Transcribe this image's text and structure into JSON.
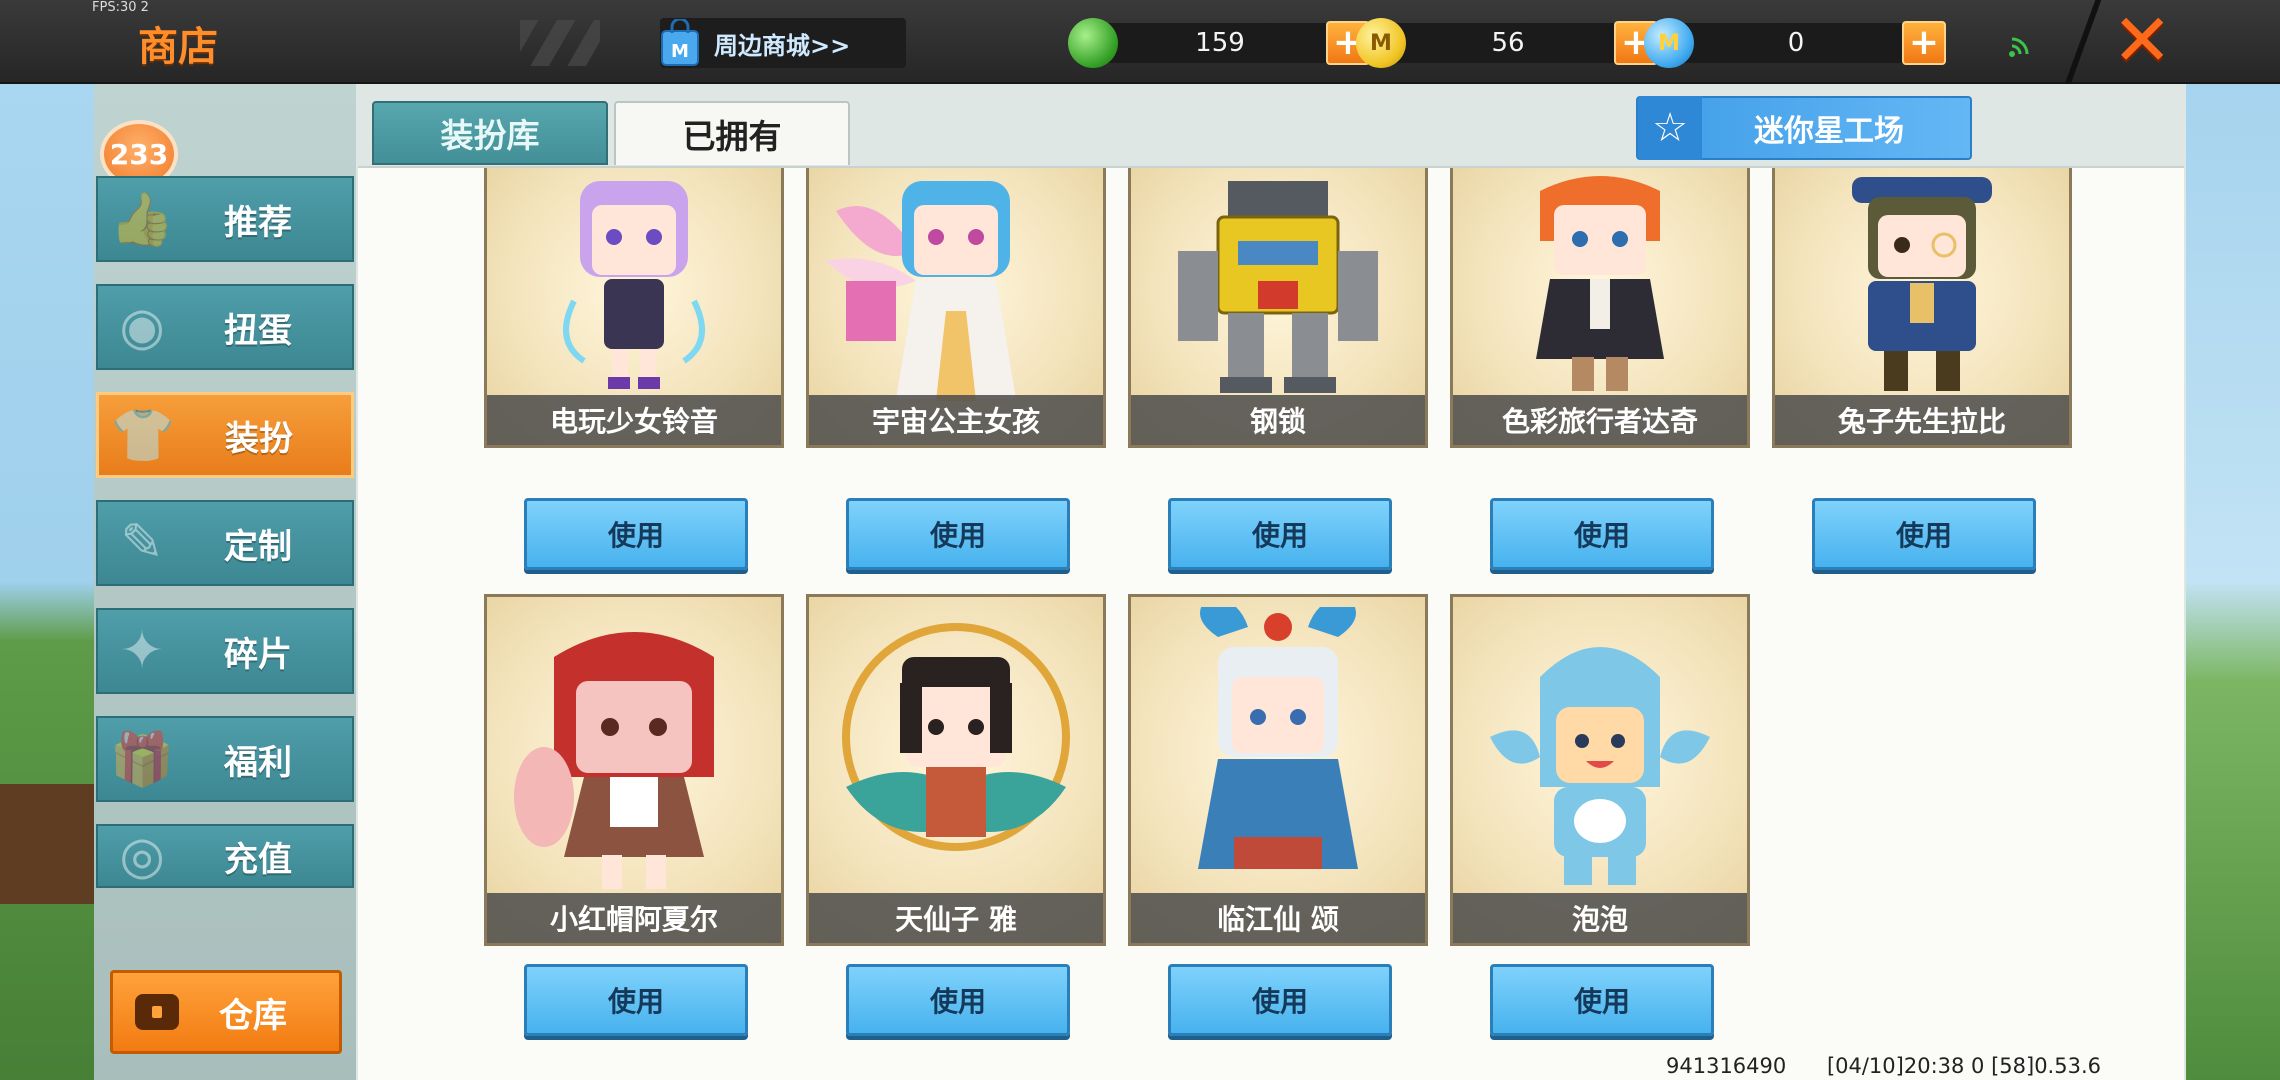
{
  "fps_text": "FPS:30 2",
  "header": {
    "title": "商店",
    "mall_link": "周边商城>>",
    "currencies": [
      {
        "name": "mini-bean",
        "value": "159",
        "icon": "green-gem-icon",
        "color": "#2f9c22"
      },
      {
        "name": "mini-coin",
        "value": "56",
        "icon": "gold-coin-icon",
        "color": "#f0c423"
      },
      {
        "name": "star-coin",
        "value": "0",
        "icon": "blue-coin-icon",
        "color": "#3ea9ef"
      }
    ],
    "plus_label": "+",
    "close_label": "✕",
    "coin_letter": "M"
  },
  "sidebar": {
    "badge_count": "233",
    "items": [
      {
        "label": "推荐",
        "icon": "thumbs-up-icon",
        "glyph": "👍",
        "active": false
      },
      {
        "label": "扭蛋",
        "icon": "capsule-icon",
        "glyph": "◉",
        "active": false
      },
      {
        "label": "装扮",
        "icon": "shirt-icon",
        "glyph": "👕",
        "active": true
      },
      {
        "label": "定制",
        "icon": "pencil-icon",
        "glyph": "✎",
        "active": false
      },
      {
        "label": "碎片",
        "icon": "puzzle-icon",
        "glyph": "✦",
        "active": false
      },
      {
        "label": "福利",
        "icon": "gift-icon",
        "glyph": "🎁",
        "active": false
      },
      {
        "label": "充值",
        "icon": "coin-stack-icon",
        "glyph": "◎",
        "active": false
      }
    ],
    "storage_label": "仓库"
  },
  "tabs": [
    {
      "label": "装扮库",
      "active": false
    },
    {
      "label": "已拥有",
      "active": true
    }
  ],
  "workshop_label": "迷你星工场",
  "use_label": "使用",
  "skins": [
    {
      "name": "电玩少女铃音",
      "hair": "#c9a4ec",
      "outfit": "#3b3554",
      "accent": "#7fd8f2"
    },
    {
      "name": "宇宙公主女孩",
      "hair": "#4fb3e8",
      "outfit": "#f5f1ec",
      "accent": "#f4a9cf"
    },
    {
      "name": "钢锁",
      "hair": "#e9c722",
      "outfit": "#8a8d92",
      "accent": "#d23b2b"
    },
    {
      "name": "色彩旅行者达奇",
      "hair": "#ef6e2b",
      "outfit": "#2d2b33",
      "accent": "#b58a62"
    },
    {
      "name": "兔子先生拉比",
      "hair": "#5b5b3a",
      "outfit": "#2e4f8c",
      "accent": "#e7c068"
    },
    {
      "name": "小红帽阿夏尔",
      "hair": "#c4302b",
      "outfit": "#8b5340",
      "accent": "#f3b7b5"
    },
    {
      "name": "天仙子 雅",
      "hair": "#2a2220",
      "outfit": "#3aa39a",
      "accent": "#e0a63a"
    },
    {
      "name": "临江仙 颂",
      "hair": "#e8eef2",
      "outfit": "#3a7fb8",
      "accent": "#c04a3a"
    },
    {
      "name": "泡泡",
      "hair": "#7fc7e6",
      "outfit": "#7fc7e6",
      "accent": "#ffd9a6"
    }
  ],
  "footer": {
    "uid": "941316490",
    "time": "[04/10]20:38 0",
    "version": "[58]0.53.6"
  }
}
